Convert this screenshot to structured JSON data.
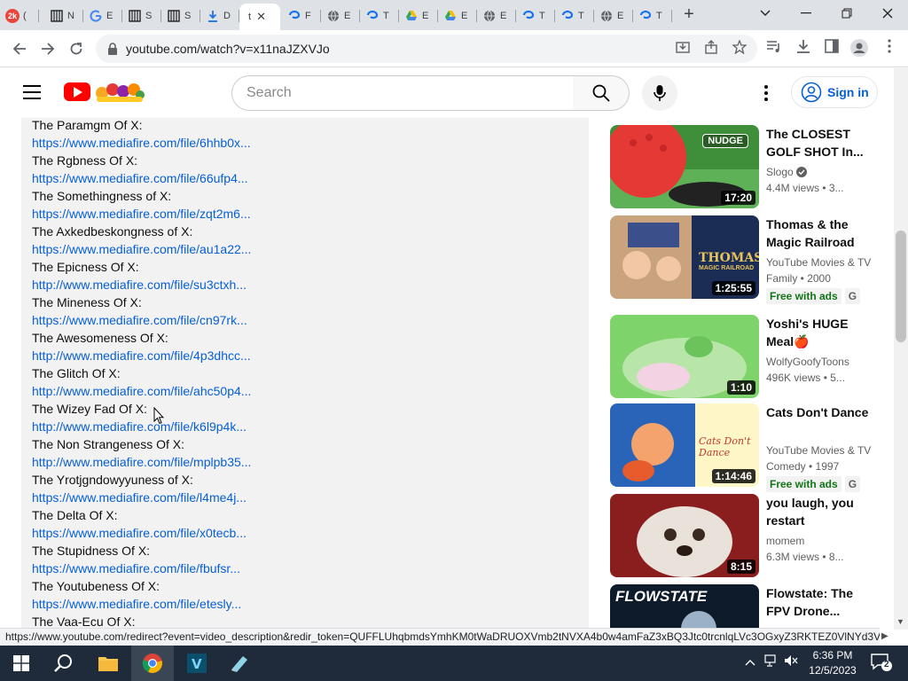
{
  "browser": {
    "tabs": [
      {
        "label": "(",
        "favicon": "2k",
        "color": "#e8453c"
      },
      {
        "label": "N",
        "favicon": "film",
        "color": "#3c4043"
      },
      {
        "label": "E",
        "favicon": "G",
        "color": "#4285f4"
      },
      {
        "label": "S",
        "favicon": "film",
        "color": "#3c4043"
      },
      {
        "label": "S",
        "favicon": "film",
        "color": "#3c4043"
      },
      {
        "label": "D",
        "favicon": "download",
        "color": "#1a73e8"
      },
      {
        "label": "t",
        "favicon": "",
        "color": "#fff",
        "active": true
      },
      {
        "label": "F",
        "favicon": "swirl",
        "color": "#1a73e8"
      },
      {
        "label": "E",
        "favicon": "globe",
        "color": "#5f6368"
      },
      {
        "label": "T",
        "favicon": "swirl",
        "color": "#1a73e8"
      },
      {
        "label": "E",
        "favicon": "drive",
        "color": "#34a853"
      },
      {
        "label": "E",
        "favicon": "drive",
        "color": "#34a853"
      },
      {
        "label": "E",
        "favicon": "globe",
        "color": "#5f6368"
      },
      {
        "label": "T",
        "favicon": "swirl",
        "color": "#1a73e8"
      },
      {
        "label": "T",
        "favicon": "swirl",
        "color": "#1a73e8"
      },
      {
        "label": "E",
        "favicon": "globe",
        "color": "#5f6368"
      },
      {
        "label": "T",
        "favicon": "swirl",
        "color": "#1a73e8"
      }
    ],
    "url": "youtube.com/watch?v=x11naJZXVJo",
    "status_url": "https://www.youtube.com/redirect?event=video_description&redir_token=QUFFLUhqbmdsYmhKM0tWaDRUOXVmb2tNVXA4b0w4amFaZ3xBQ3Jtc0trcnlqLVc3OGxyZ3RKTEZ0VlNYd3V1..."
  },
  "youtube": {
    "search_placeholder": "Search",
    "signin_label": "Sign in",
    "brand_red": "#ff0000",
    "link_color": "#065fd4"
  },
  "description": [
    {
      "title": "The Paramgm Of X:",
      "link": "https://www.mediafire.com/file/6hhb0x..."
    },
    {
      "title": "The Rgbness Of X:",
      "link": "https://www.mediafire.com/file/66ufp4..."
    },
    {
      "title": "The Somethingness of X:",
      "link": "https://www.mediafire.com/file/zqt2m6..."
    },
    {
      "title": "The Axkedbeskongness of X:",
      "link": "https://www.mediafire.com/file/au1a22..."
    },
    {
      "title": "The Epicness Of X:",
      "link": "http://www.mediafire.com/file/su3ctxh..."
    },
    {
      "title": "The Mineness Of X:",
      "link": "https://www.mediafire.com/file/cn97rk..."
    },
    {
      "title": "The Awesomeness Of X:",
      "link": "http://www.mediafire.com/file/4p3dhcc..."
    },
    {
      "title": "The Glitch Of X:",
      "link": "http://www.mediafire.com/file/ahc50p4..."
    },
    {
      "title": "The Wizey Fad Of X:",
      "link": "http://www.mediafire.com/file/k6l9p4k..."
    },
    {
      "title": "The Non Strangeness Of X:",
      "link": "http://www.mediafire.com/file/mplpb35..."
    },
    {
      "title": "The Yrotjgndowyyuness of X:",
      "link": "https://www.mediafire.com/file/l4me4j..."
    },
    {
      "title": "The Delta Of X:",
      "link": "https://www.mediafire.com/file/x0tecb..."
    },
    {
      "title": "The Stupidness Of X:",
      "link": "https://www.mediafire.com/file/fbufsr..."
    },
    {
      "title": "The Youtubeness Of X:",
      "link": "https://www.mediafire.com/file/etesly..."
    },
    {
      "title": "The Vaa-Ecu Of X:",
      "link": ""
    }
  ],
  "recommendations": [
    {
      "title_1": "The CLOSEST",
      "title_2": "GOLF SHOT In...",
      "channel": "Slogo",
      "meta": "4.4M views  •  3...",
      "duration": "17:20",
      "badge": "",
      "rating": "",
      "thumb_label": "NUDGE",
      "verified": true
    },
    {
      "title_1": "Thomas & the",
      "title_2": "Magic Railroad",
      "channel": "YouTube Movies & TV",
      "meta": "Family • 2000",
      "duration": "1:25:55",
      "badge": "Free with ads",
      "rating": "G",
      "thumb_label": "THOMAS",
      "thumb_sub": "MAGIC RAILROAD",
      "verified": false
    },
    {
      "title_1": "Yoshi's HUGE",
      "title_2": "Meal🍎",
      "channel": "WolfyGoofyToons",
      "meta": "496K views  •  5...",
      "duration": "1:10",
      "badge": "",
      "rating": "",
      "thumb_label": "",
      "verified": false
    },
    {
      "title_1": "Cats Don't Dance",
      "title_2": "",
      "channel": "YouTube Movies & TV",
      "meta": "Comedy • 1997",
      "duration": "1:14:46",
      "badge": "Free with ads",
      "rating": "G",
      "thumb_label": "Cats Don't Dance",
      "verified": false
    },
    {
      "title_1": "you laugh, you",
      "title_2": "restart",
      "channel": "momem",
      "meta": "6.3M views  •  8...",
      "duration": "8:15",
      "badge": "",
      "rating": "",
      "thumb_label": "",
      "verified": false
    },
    {
      "title_1": "Flowstate: The",
      "title_2": "FPV Drone...",
      "channel": "",
      "meta": "",
      "duration": "",
      "badge": "",
      "rating": "",
      "thumb_label": "FLOWSTATE",
      "verified": false
    }
  ],
  "taskbar": {
    "time": "6:36 PM",
    "date": "12/5/2023",
    "notifications": "2"
  }
}
